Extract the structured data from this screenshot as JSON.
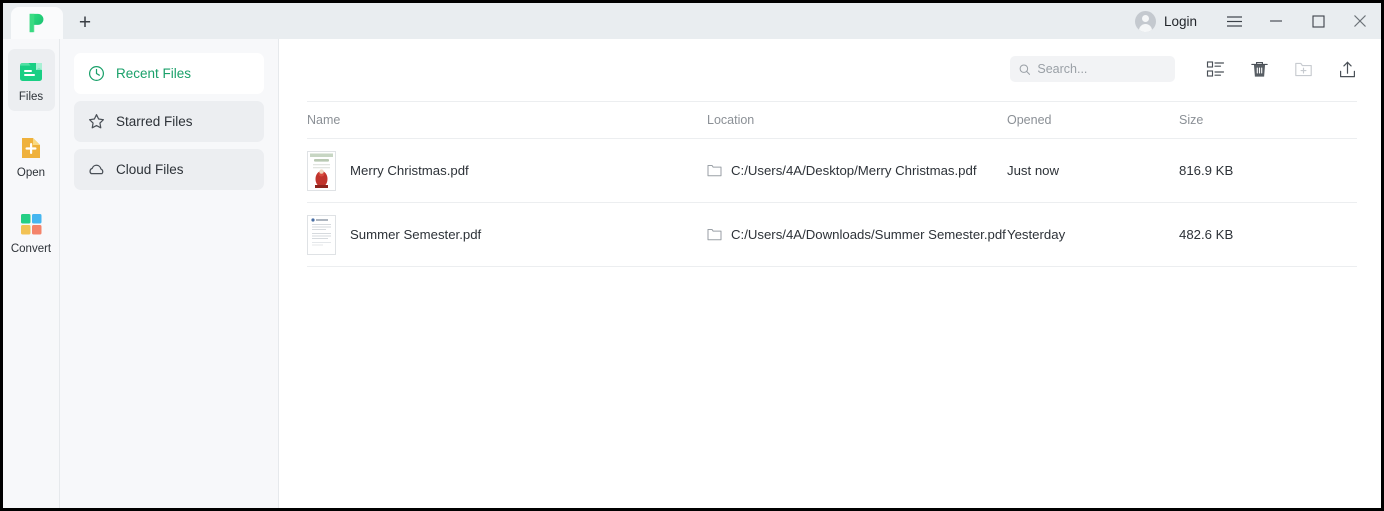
{
  "window": {
    "tab_icon": "app-logo-p-icon",
    "new_tab_label": "+",
    "login_label": "Login",
    "menu_icon": "hamburger-menu-icon",
    "minimize_icon": "minimize-icon",
    "maximize_icon": "maximize-icon",
    "close_icon": "close-icon"
  },
  "rail": {
    "items": [
      {
        "label": "Files",
        "icon": "files-icon",
        "active": true
      },
      {
        "label": "Open",
        "icon": "open-file-plus-icon",
        "active": false
      },
      {
        "label": "Convert",
        "icon": "convert-grid-icon",
        "active": false
      }
    ]
  },
  "nav": {
    "items": [
      {
        "label": "Recent Files",
        "icon": "clock-icon",
        "active": true
      },
      {
        "label": "Starred Files",
        "icon": "star-icon",
        "active": false
      },
      {
        "label": "Cloud Files",
        "icon": "cloud-icon",
        "active": false
      }
    ]
  },
  "toolbar": {
    "search_placeholder": "Search...",
    "search_value": "",
    "search_icon": "search-icon",
    "buttons": [
      {
        "name": "list-view-icon",
        "disabled": false
      },
      {
        "name": "trash-icon",
        "disabled": false
      },
      {
        "name": "new-folder-icon",
        "disabled": true
      },
      {
        "name": "upload-icon",
        "disabled": false
      }
    ]
  },
  "table": {
    "columns": [
      "Name",
      "Location",
      "Opened",
      "Size"
    ],
    "rows": [
      {
        "name": "Merry Christmas.pdf",
        "location": "C:/Users/4A/Desktop/Merry Christmas.pdf",
        "opened": "Just now",
        "size": "816.9 KB",
        "thumb": "christmas-pdf-thumbnail"
      },
      {
        "name": "Summer Semester.pdf",
        "location": "C:/Users/4A/Downloads/Summer Semester.pdf",
        "opened": "Yesterday",
        "size": "482.6 KB",
        "thumb": "document-pdf-thumbnail"
      }
    ]
  },
  "colors": {
    "accent_green": "#1aa06a",
    "logo_green": "#24c97f",
    "rail_bg": "#f7f8fa",
    "titlebar_bg": "#e9edf0",
    "open_icon_yellow": "#f0b93f",
    "convert_blue": "#45b6f0",
    "convert_red": "#f4836a"
  }
}
